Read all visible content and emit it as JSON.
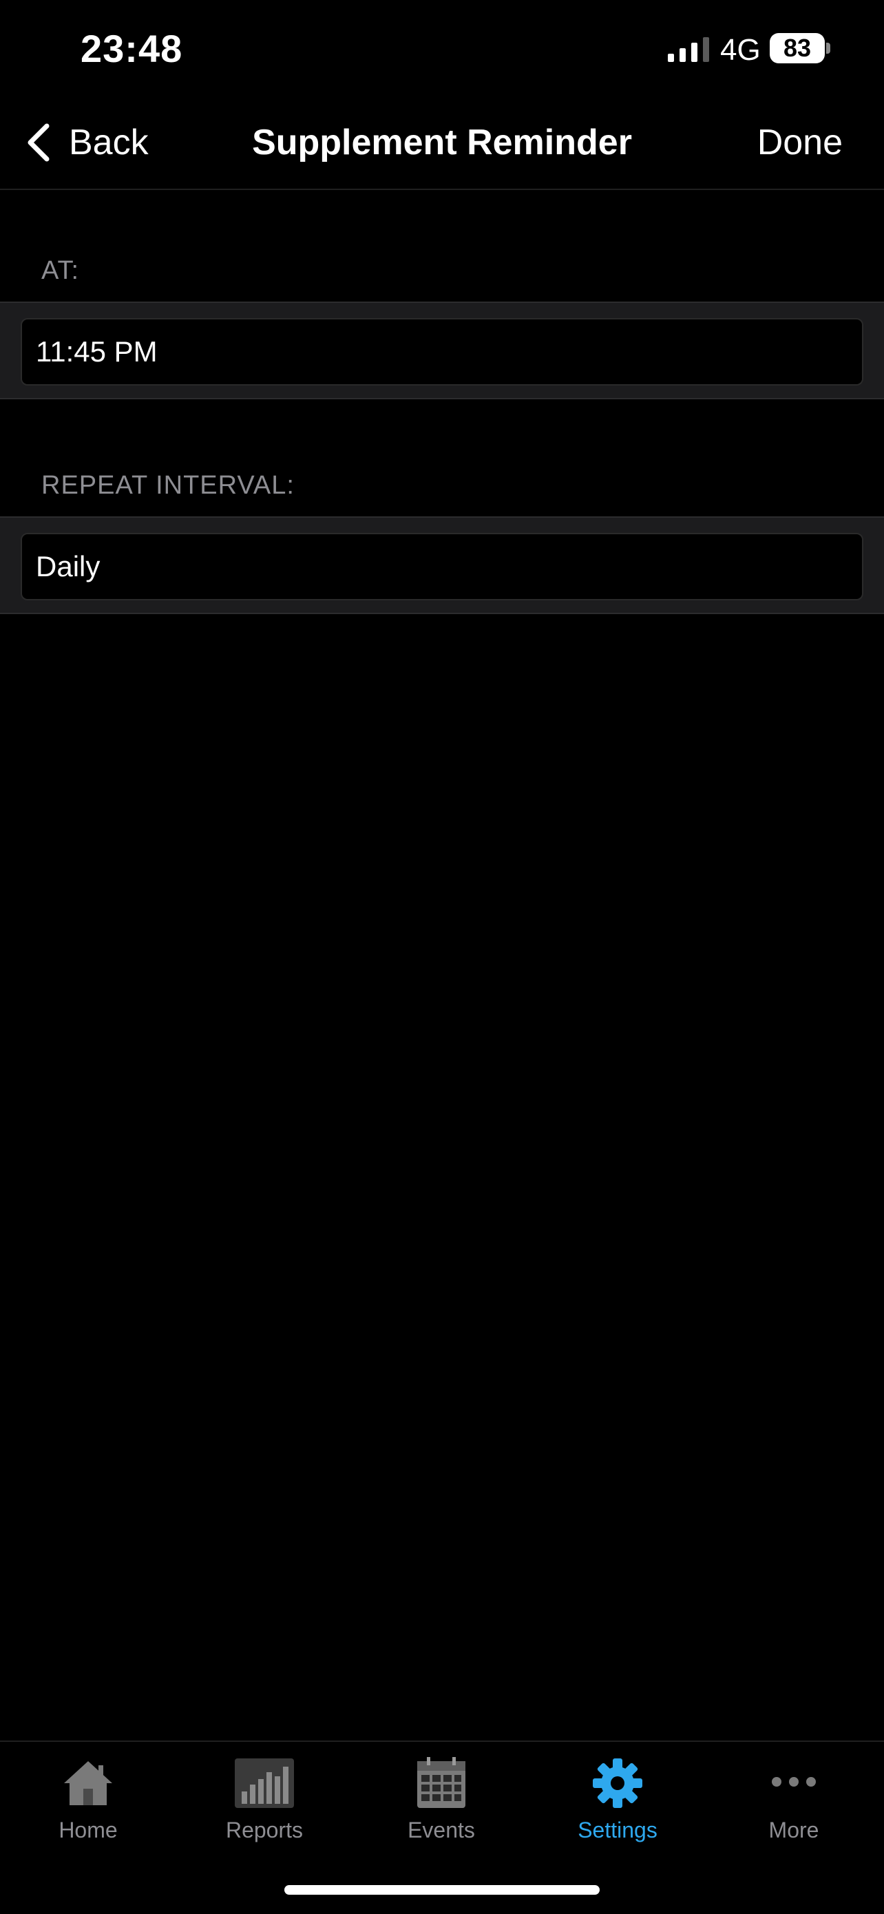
{
  "status_bar": {
    "time": "23:48",
    "network": "4G",
    "battery": "83"
  },
  "nav": {
    "back_label": "Back",
    "title": "Supplement Reminder",
    "done_label": "Done"
  },
  "sections": {
    "time": {
      "header": "AT:",
      "value": "11:45 PM"
    },
    "repeat": {
      "header": "REPEAT INTERVAL:",
      "value": "Daily"
    }
  },
  "tabs": [
    {
      "label": "Home",
      "icon": "house-icon",
      "active": false
    },
    {
      "label": "Reports",
      "icon": "bar-chart-icon",
      "active": false
    },
    {
      "label": "Events",
      "icon": "calendar-icon",
      "active": false
    },
    {
      "label": "Settings",
      "icon": "gear-icon",
      "active": true
    },
    {
      "label": "More",
      "icon": "more-dots-icon",
      "active": false
    }
  ],
  "colors": {
    "accent": "#2ea8ee",
    "inactive_tab": "#8e8e93",
    "background": "#000000",
    "section_band": "#1c1c1e"
  }
}
